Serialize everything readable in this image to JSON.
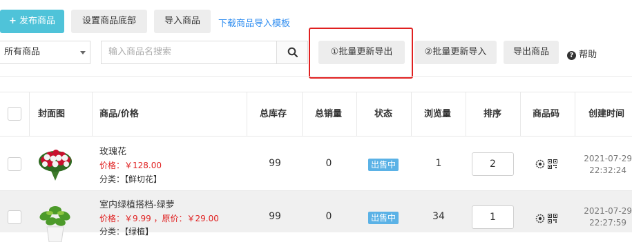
{
  "toolbar": {
    "publish_label": "发布商品",
    "set_bottom_label": "设置商品底部",
    "import_label": "导入商品",
    "download_template_label": "下载商品导入模板"
  },
  "filters": {
    "category_value": "所有商品",
    "search_placeholder": "输入商品名搜索",
    "bulk_export_label": "①批量更新导出",
    "bulk_import_label": "②批量更新导入",
    "export_label": "导出商品",
    "help_label": "帮助"
  },
  "table": {
    "headers": {
      "cover": "封面图",
      "product": "商品/价格",
      "stock": "总库存",
      "sales": "总销量",
      "status": "状态",
      "views": "浏览量",
      "sort": "排序",
      "code": "商品码",
      "created": "创建时间"
    },
    "rows": [
      {
        "name": "玫瑰花",
        "price": "价格：￥128.00",
        "category": "分类：【鲜切花】",
        "stock": "99",
        "sales": "0",
        "status": "出售中",
        "views": "1",
        "sort": "2",
        "date": "2021-07-29",
        "time": "22:32:24"
      },
      {
        "name": "室内绿植搭档-绿萝",
        "price": "价格：￥9.99 ，原价：￥29.00",
        "category": "分类：【绿植】",
        "stock": "99",
        "sales": "0",
        "status": "出售中",
        "views": "34",
        "sort": "1",
        "date": "2021-07-29",
        "time": "22:27:59"
      }
    ]
  },
  "colors": {
    "primary": "#4fc3d9",
    "link": "#2d8cf0",
    "price": "#e02020",
    "badge": "#5bb2e6",
    "highlight": "#e02020"
  }
}
